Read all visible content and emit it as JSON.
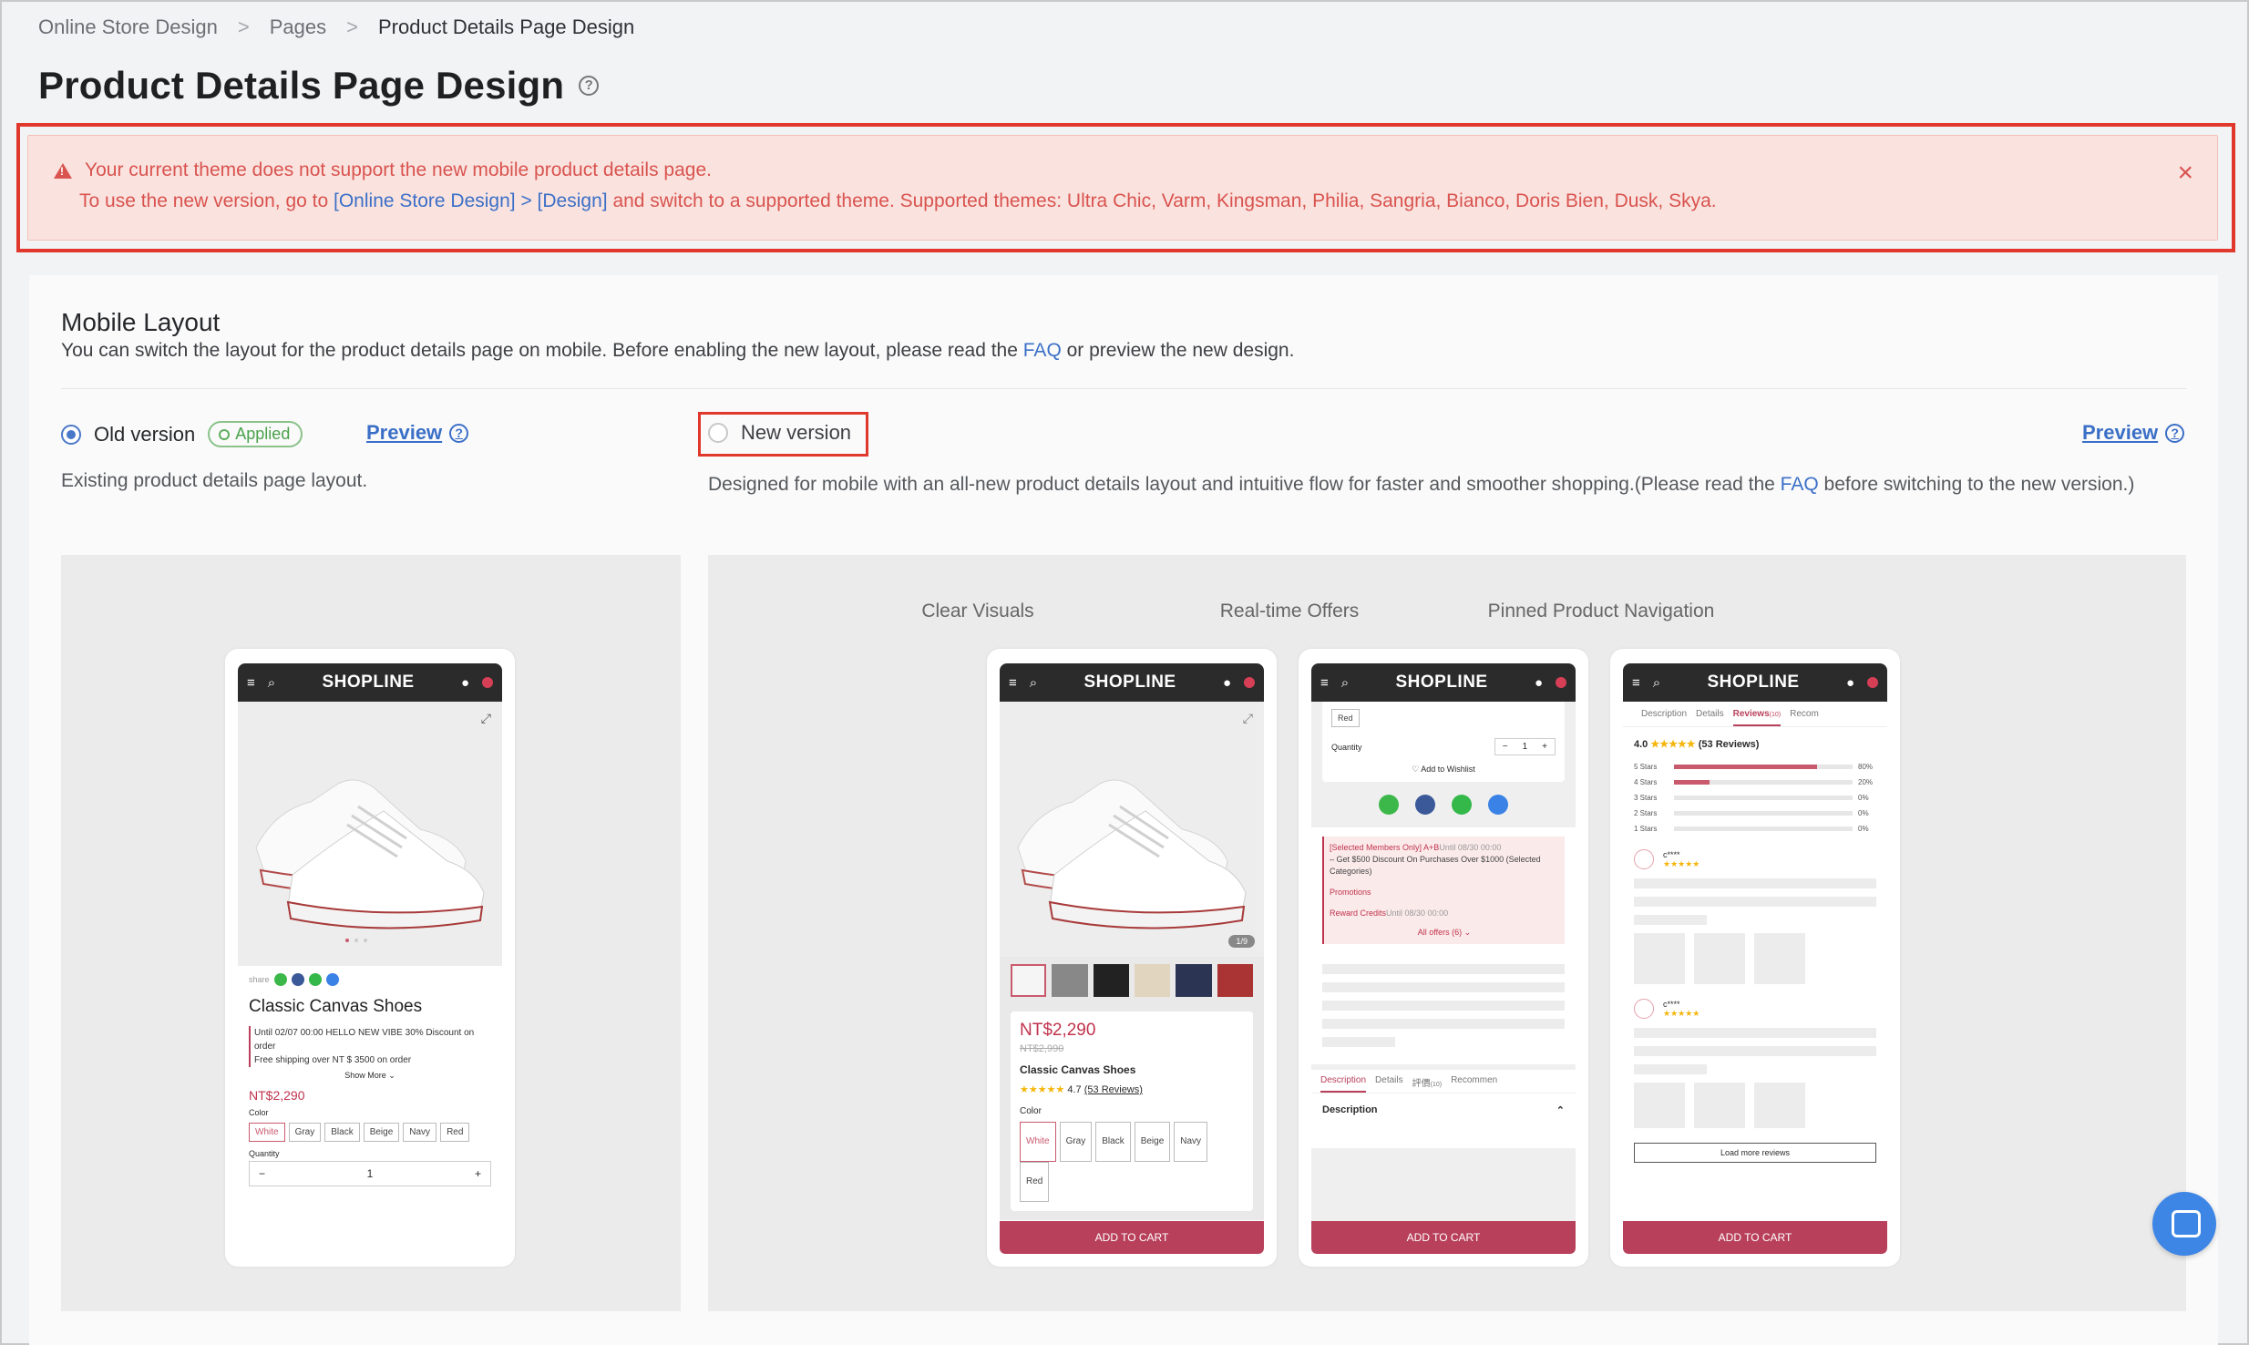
{
  "breadcrumb": {
    "items": [
      "Online Store Design",
      "Pages",
      "Product Details Page Design"
    ],
    "separator": ">"
  },
  "page_title": "Product Details Page Design",
  "alert": {
    "line1": "Your current theme does not support the new mobile product details page.",
    "line2_prefix": "To use the new version, go to",
    "line2_link": "[Online Store Design] > [Design]",
    "line2_suffix": "and switch to a supported theme. Supported themes: Ultra Chic, Varm, Kingsman, Philia, Sangria, Bianco, Doris Bien, Dusk, Skya.",
    "close": "×"
  },
  "mobile_layout": {
    "title": "Mobile Layout",
    "desc_prefix": "You can switch the layout for the product details page on mobile. Before enabling the new layout, please read the",
    "desc_link": "FAQ",
    "desc_suffix": "or preview the new design."
  },
  "old_version": {
    "label": "Old version",
    "badge": "Applied",
    "preview": "Preview",
    "desc": "Existing product details page layout."
  },
  "new_version": {
    "label": "New version",
    "preview": "Preview",
    "desc_prefix": "Designed for mobile with an all-new product details layout and intuitive flow for faster and smoother shopping.(Please read the",
    "desc_link": "FAQ",
    "desc_suffix": "before switching to the new version.)"
  },
  "columns": [
    "Clear Visuals",
    "Real-time Offers",
    "Pinned Product Navigation"
  ],
  "phone_common": {
    "logo": "SHOPLINE",
    "add_to_cart": "ADD TO CART"
  },
  "old_phone": {
    "share": "share",
    "product_name": "Classic Canvas Shoes",
    "promo1": "Until 02/07 00:00 HELLO NEW VIBE 30% Discount on order",
    "promo2": "Free shipping over NT $ 3500 on order",
    "show_more": "Show More",
    "price": "NT$2,290",
    "color_label": "Color",
    "colors": [
      "White",
      "Gray",
      "Black",
      "Beige",
      "Navy",
      "Red"
    ],
    "quantity_label": "Quantity",
    "quantity": "1"
  },
  "visuals_phone": {
    "counter": "1/9",
    "price": "NT$2,290",
    "old_price": "NT$2,990",
    "product_name": "Classic Canvas Shoes",
    "rating": "4.7",
    "reviews": "(53 Reviews)",
    "color_label": "Color",
    "colors": [
      "White",
      "Gray",
      "Black",
      "Beige",
      "Navy",
      "Red"
    ]
  },
  "offers_phone": {
    "color_red": "Red",
    "quantity_label": "Quantity",
    "quantity": "1",
    "wishlist": "Add to Wishlist",
    "offer_line1": "[Selected Members Only] A+B",
    "offer_until": "Until 08/30 00:00",
    "offer_line2": "– Get $500 Discount On Purchases Over $1000 (Selected Categories)",
    "promotions": "Promotions",
    "reward_credits": "Reward Credits",
    "reward_until": "Until 08/30 00:00",
    "all_offers": "All offers (6)",
    "tabs": [
      "Description",
      "Details",
      "評價",
      "Recommen"
    ],
    "review_count_tag": "(10)",
    "section": "Description"
  },
  "nav_phone": {
    "tabs": [
      "Description",
      "Details",
      "Reviews",
      "Recom"
    ],
    "review_count_tag": "(10)",
    "rating": "4.0",
    "reviews": "(53 Reviews)",
    "star_rows": [
      {
        "label": "5 Stars",
        "pct": "80%",
        "value": 0.8
      },
      {
        "label": "4 Stars",
        "pct": "20%",
        "value": 0.2
      },
      {
        "label": "3 Stars",
        "pct": "0%",
        "value": 0
      },
      {
        "label": "2 Stars",
        "pct": "0%",
        "value": 0
      },
      {
        "label": "1 Stars",
        "pct": "0%",
        "value": 0
      }
    ],
    "reviewer1": "c****",
    "reviewer2": "c****",
    "load_more": "Load more reviews"
  },
  "colors": {
    "accent_blue": "#3b6fc7",
    "alert_red": "#d9534f",
    "highlight_red": "#e0382d",
    "brand_pink": "#b8405b",
    "applied_green": "#4aa14a"
  }
}
